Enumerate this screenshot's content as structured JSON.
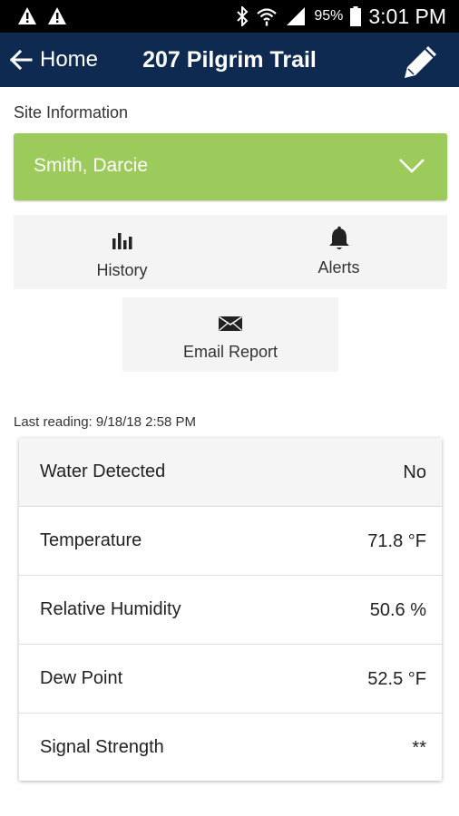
{
  "status_bar": {
    "battery_percent": "95%",
    "time": "3:01 PM",
    "icons": [
      "warning-icon",
      "warning-icon",
      "bluetooth-icon",
      "wifi-icon",
      "signal-icon",
      "battery-icon"
    ]
  },
  "app_bar": {
    "back_label": "Home",
    "title": "207 Pilgrim Trail",
    "edit_icon": "pencil-icon",
    "background_color": "#0e2a50"
  },
  "site_info": {
    "section_label": "Site Information",
    "owner_name": "Smith, Darcie",
    "owner_color": "#9ccb5c"
  },
  "actions": {
    "history_label": "History",
    "alerts_label": "Alerts",
    "email_label": "Email Report"
  },
  "last_reading": "Last reading: 9/18/18 2:58 PM",
  "readings": [
    {
      "label": "Water Detected",
      "value": "No"
    },
    {
      "label": "Temperature",
      "value": "71.8 °F"
    },
    {
      "label": "Relative Humidity",
      "value": "50.6 %"
    },
    {
      "label": "Dew Point",
      "value": "52.5 °F"
    },
    {
      "label": "Signal Strength",
      "value": "**"
    }
  ]
}
